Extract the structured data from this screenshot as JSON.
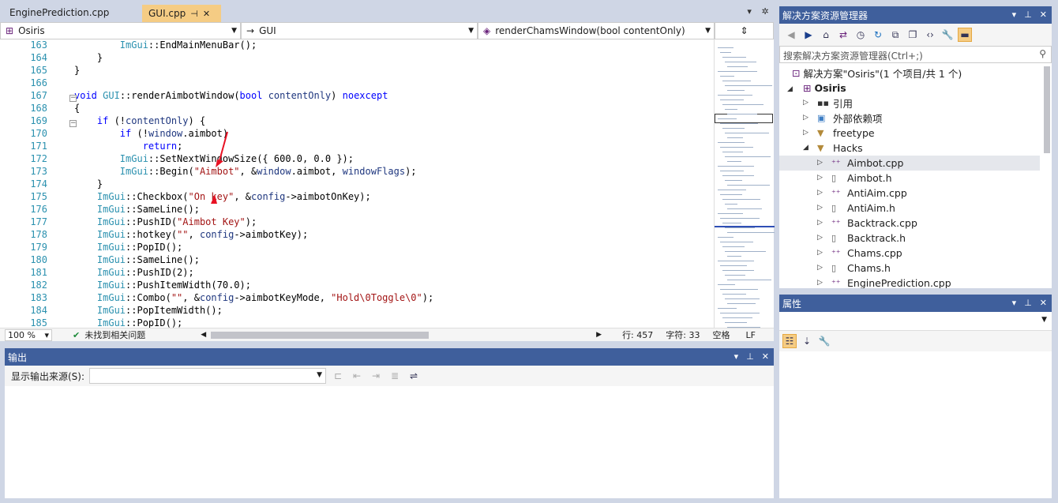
{
  "tabs": {
    "inactive": "EnginePrediction.cpp",
    "active": "GUI.cpp"
  },
  "nav": {
    "project": "Osiris",
    "scope": "GUI",
    "member": "renderChamsWindow(bool contentOnly)"
  },
  "code": {
    "lines": [
      {
        "n": "163",
        "t": "        ImGui::EndMainMenuBar();"
      },
      {
        "n": "164",
        "t": "    }"
      },
      {
        "n": "165",
        "t": "}"
      },
      {
        "n": "166",
        "t": ""
      },
      {
        "n": "167",
        "t": "void GUI::renderAimbotWindow(bool contentOnly) noexcept"
      },
      {
        "n": "168",
        "t": "{"
      },
      {
        "n": "169",
        "t": "    if (!contentOnly) {"
      },
      {
        "n": "170",
        "t": "        if (!window.aimbot)"
      },
      {
        "n": "171",
        "t": "            return;"
      },
      {
        "n": "172",
        "t": "        ImGui::SetNextWindowSize({ 600.0f, 0.0f });"
      },
      {
        "n": "173",
        "t": "        ImGui::Begin(\"Aimbot\", &window.aimbot, windowFlags);"
      },
      {
        "n": "174",
        "t": "    }"
      },
      {
        "n": "175",
        "t": "    ImGui::Checkbox(\"On key\", &config->aimbotOnKey);"
      },
      {
        "n": "176",
        "t": "    ImGui::SameLine();"
      },
      {
        "n": "177",
        "t": "    ImGui::PushID(\"Aimbot Key\");"
      },
      {
        "n": "178",
        "t": "    ImGui::hotkey(\"\", config->aimbotKey);"
      },
      {
        "n": "179",
        "t": "    ImGui::PopID();"
      },
      {
        "n": "180",
        "t": "    ImGui::SameLine();"
      },
      {
        "n": "181",
        "t": "    ImGui::PushID(2);"
      },
      {
        "n": "182",
        "t": "    ImGui::PushItemWidth(70.0f);"
      },
      {
        "n": "183",
        "t": "    ImGui::Combo(\"\", &config->aimbotKeyMode, \"Hold\\0Toggle\\0\");"
      },
      {
        "n": "184",
        "t": "    ImGui::PopItemWidth();"
      },
      {
        "n": "185",
        "t": "    ImGui::PopID();"
      }
    ]
  },
  "status": {
    "zoom": "100 %",
    "issues": "未找到相关问题",
    "line": "行: 457",
    "col": "字符: 33",
    "spaces": "空格",
    "eol": "LF"
  },
  "output": {
    "title": "输出",
    "source_label": "显示输出来源(S):",
    "source_value": ""
  },
  "solution": {
    "title": "解决方案资源管理器",
    "search_placeholder": "搜索解决方案资源管理器(Ctrl+;)",
    "root": "解决方案\"Osiris\"(1 个项目/共 1 个)",
    "project": "Osiris",
    "items": [
      {
        "label": "引用",
        "indent": 1,
        "icon": "references-icon"
      },
      {
        "label": "外部依赖项",
        "indent": 1,
        "icon": "external-deps-icon"
      },
      {
        "label": "freetype",
        "indent": 1,
        "icon": "filter-folder-icon"
      },
      {
        "label": "Hacks",
        "indent": 1,
        "icon": "filter-folder-icon",
        "open": true
      },
      {
        "label": "Aimbot.cpp",
        "indent": 2,
        "icon": "cpp-file-icon",
        "selected": true
      },
      {
        "label": "Aimbot.h",
        "indent": 2,
        "icon": "header-file-icon"
      },
      {
        "label": "AntiAim.cpp",
        "indent": 2,
        "icon": "cpp-file-icon"
      },
      {
        "label": "AntiAim.h",
        "indent": 2,
        "icon": "header-file-icon"
      },
      {
        "label": "Backtrack.cpp",
        "indent": 2,
        "icon": "cpp-file-icon"
      },
      {
        "label": "Backtrack.h",
        "indent": 2,
        "icon": "header-file-icon"
      },
      {
        "label": "Chams.cpp",
        "indent": 2,
        "icon": "cpp-file-icon"
      },
      {
        "label": "Chams.h",
        "indent": 2,
        "icon": "header-file-icon"
      },
      {
        "label": "EnginePrediction.cpp",
        "indent": 2,
        "icon": "cpp-file-icon"
      }
    ]
  },
  "properties": {
    "title": "属性"
  },
  "colors": {
    "accent": "#3f5f9c",
    "activeTab": "#f5cc84",
    "arrow": "#e81123"
  }
}
